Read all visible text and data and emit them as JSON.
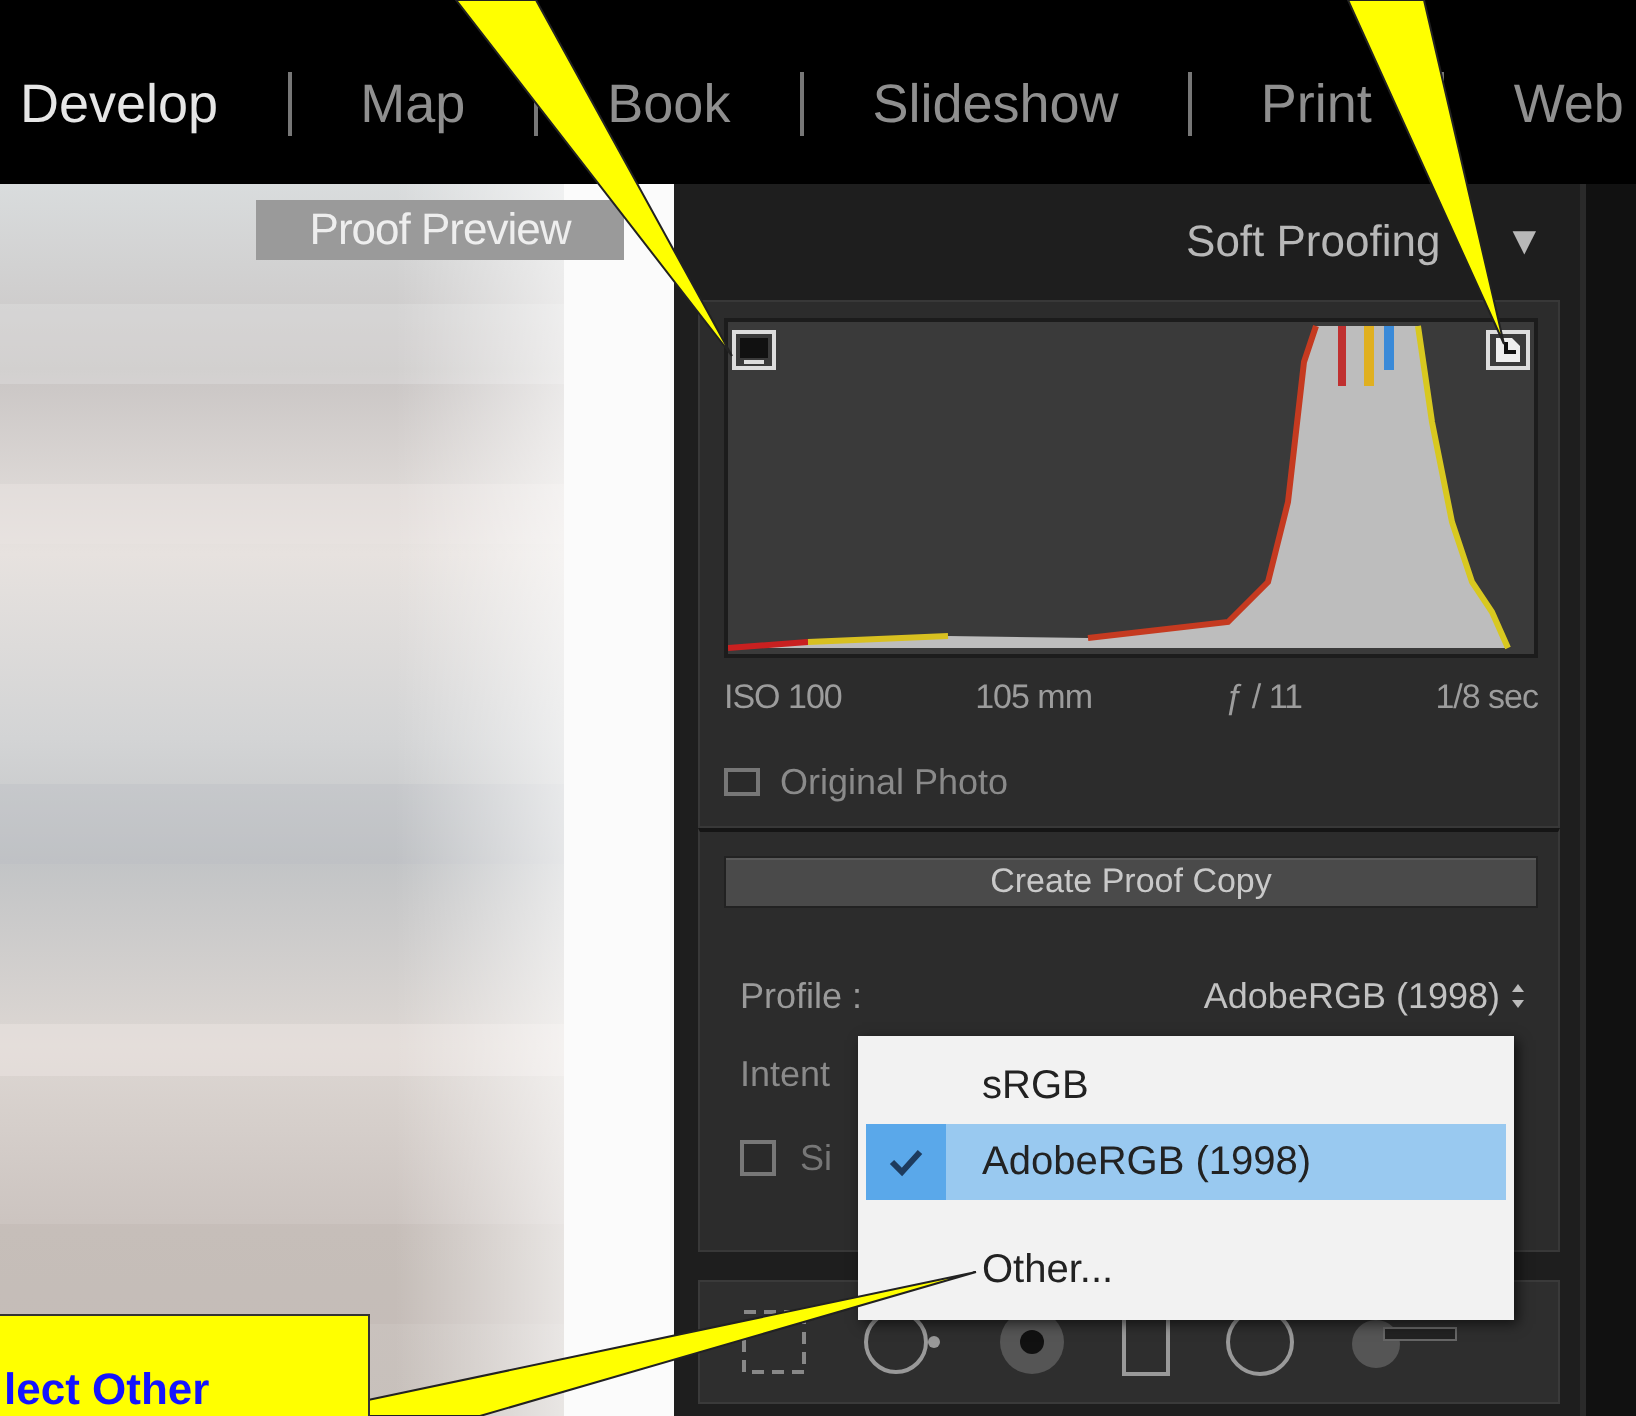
{
  "module_tabs": [
    {
      "label": "Develop",
      "selected": true
    },
    {
      "label": "Map",
      "selected": false
    },
    {
      "label": "Book",
      "selected": false
    },
    {
      "label": "Slideshow",
      "selected": false
    },
    {
      "label": "Print",
      "selected": false
    },
    {
      "label": "Web",
      "selected": false
    }
  ],
  "preview": {
    "label": "Proof Preview"
  },
  "panel": {
    "title": "Soft Proofing",
    "toggle": "▼"
  },
  "histogram": {
    "info": [
      "ISO 100",
      "105 mm",
      "ƒ / 11",
      "1/8 sec"
    ]
  },
  "original_photo": {
    "label": "Original Photo",
    "checked": false
  },
  "create_button": {
    "label": "Create Proof Copy"
  },
  "profile": {
    "label": "Profile :",
    "value": "AdobeRGB (1998)"
  },
  "intent": {
    "label": "Intent"
  },
  "simulate": {
    "label": "Si",
    "checked": false
  },
  "menu": {
    "items": [
      {
        "kind": "option",
        "label": "sRGB",
        "selected": false
      },
      {
        "kind": "option",
        "label": "AdobeRGB (1998)",
        "selected": true
      },
      {
        "kind": "separator"
      },
      {
        "kind": "option",
        "label": "Other...",
        "selected": false
      }
    ]
  },
  "callout": {
    "text": "lect Other"
  }
}
